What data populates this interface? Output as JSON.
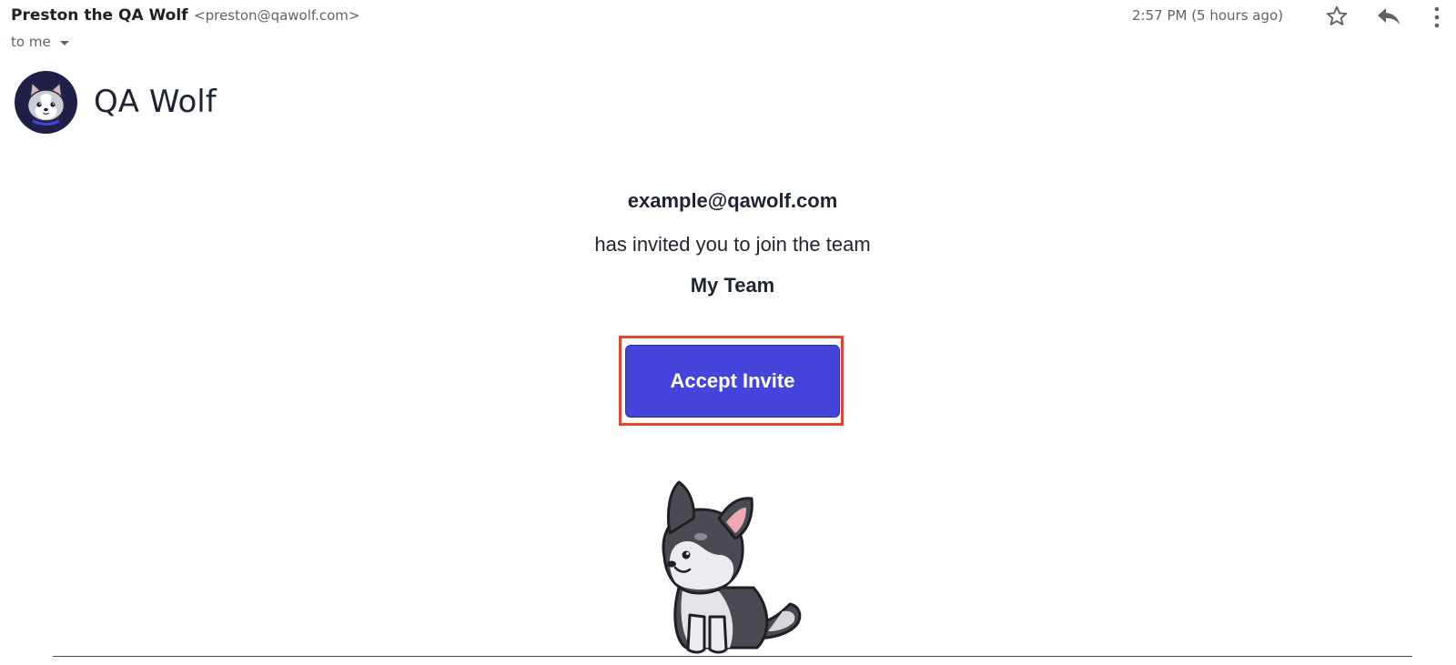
{
  "email_header": {
    "sender_name": "Preston the QA Wolf",
    "sender_email": "<preston@qawolf.com>",
    "recipient_label": "to me",
    "timestamp": "2:57 PM (5 hours ago)",
    "icons": [
      "star-icon",
      "reply-icon",
      "more-vert-icon",
      "chevron-down-icon"
    ]
  },
  "brand": {
    "name": "QA Wolf",
    "logo_icon": "wolf-avatar-icon"
  },
  "message": {
    "inviter_email": "example@qawolf.com",
    "invite_text": "has invited you to join the team",
    "team_name": "My Team",
    "accept_button_label": "Accept Invite",
    "mascot_icon": "wolf-mascot-illustration"
  },
  "colors": {
    "button": "#4545dc",
    "highlight": "#e5442e",
    "text_dark": "#1f2433",
    "logo_bg": "#1f1f47"
  }
}
